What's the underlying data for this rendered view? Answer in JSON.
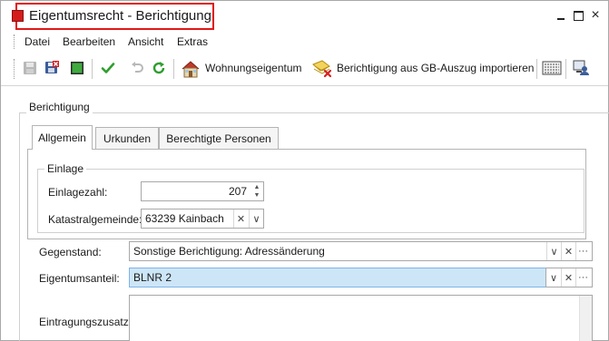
{
  "window": {
    "title": "Eigentumsrecht - Berichtigung",
    "controls": {
      "minimize": "_",
      "maximize": "□",
      "close": "×"
    }
  },
  "menu": [
    "Datei",
    "Bearbeiten",
    "Ansicht",
    "Extras"
  ],
  "toolbar": {
    "wohnungseigentum_label": "Wohnungseigentum",
    "berichtigung_label": "Berichtigung aus GB-Auszug importieren",
    "icons": [
      "save-disabled-icon",
      "save-close-icon",
      "green-square-icon",
      "checkmark-icon",
      "undo-icon",
      "refresh-icon",
      "house-icon",
      "document-import-icon",
      "keyboard-icon",
      "user-computer-icon"
    ]
  },
  "form": {
    "group_title": "Berichtigung",
    "tabs": [
      "Allgemein",
      "Urkunden",
      "Berechtigte Personen"
    ],
    "active_tab": "Allgemein",
    "einlage": {
      "group_title": "Einlage",
      "einlagezahl_label": "Einlagezahl:",
      "einlagezahl_value": "207",
      "katastral_label": "Katastralgemeinde:",
      "katastral_value": "63239 Kainbach"
    },
    "gegenstand_label": "Gegenstand:",
    "gegenstand_value": "Sonstige Berichtigung: Adressänderung",
    "eigentumsanteil_label": "Eigentumsanteil:",
    "eigentumsanteil_value": "BLNR 2",
    "eintragungszusatz_label": "Eintragungszusatz:"
  },
  "colors": {
    "highlight_border": "#e01818",
    "selected_field": "#cde6f7",
    "accent_green": "#2e9e2e"
  }
}
